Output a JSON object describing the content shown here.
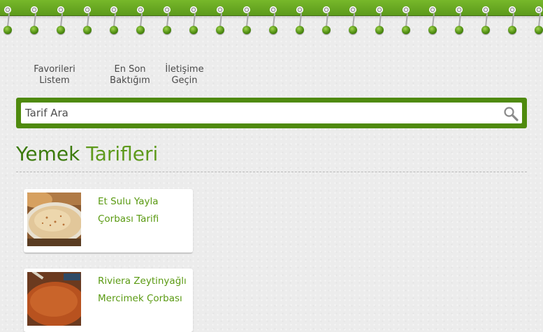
{
  "nav": {
    "favorites": [
      "Favorileri",
      "Listem"
    ],
    "recent": [
      "En Son",
      "Baktığım"
    ],
    "contact": [
      "İletişime",
      "Geçin"
    ]
  },
  "search": {
    "placeholder": "Tarif Ara",
    "icon": "magnifier-icon"
  },
  "page_title": {
    "part1": "Yemek",
    "part2": "Tarifleri"
  },
  "recipes": [
    {
      "title_line1": "Et Sulu Yayla",
      "title_line2": "Çorbası Tarifi"
    },
    {
      "title_line1": "Riviera Zeytinyağlı",
      "title_line2": "Mercimek Çorbası"
    }
  ],
  "colors": {
    "brand_green": "#5c9a1b",
    "search_frame": "#4f8a0e",
    "title_dark_green": "#3c7b0c",
    "link_green": "#5a9a12"
  }
}
